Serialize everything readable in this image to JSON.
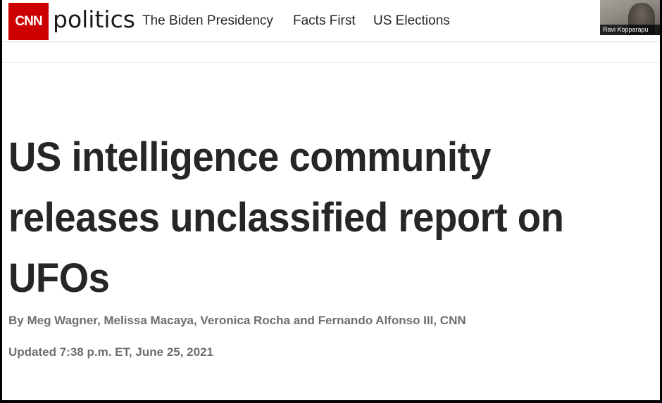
{
  "header": {
    "logo_text": "CNN",
    "section": "politics",
    "nav": [
      {
        "label": "The Biden Presidency"
      },
      {
        "label": "Facts First"
      },
      {
        "label": "US Elections"
      }
    ]
  },
  "video_call": {
    "participant_name": "Ravi Kopparapu"
  },
  "article": {
    "headline": "US intelligence community releases unclassified report on UFOs",
    "byline": "By Meg Wagner, Melissa Macaya, Veronica Rocha and Fernando Alfonso III, CNN",
    "updated": "Updated 7:38 p.m. ET, June 25, 2021"
  },
  "colors": {
    "brand_red": "#cc0000",
    "headline": "#262626",
    "meta_text": "#6e6e6e"
  },
  "icons": [
    "cnn-logo",
    "video-participant"
  ]
}
